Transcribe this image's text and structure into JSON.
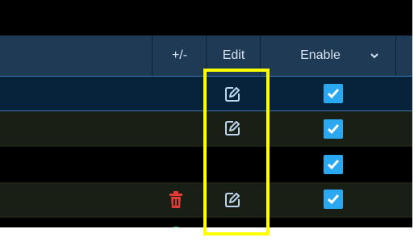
{
  "table": {
    "columns": {
      "plus_minus": "+/-",
      "edit": "Edit",
      "enable": "Enable"
    },
    "rows": [
      {
        "has_edit": true,
        "has_delete": false,
        "enabled": true
      },
      {
        "has_edit": true,
        "has_delete": false,
        "enabled": true
      },
      {
        "has_edit": false,
        "has_delete": false,
        "enabled": true
      },
      {
        "has_edit": true,
        "has_delete": true,
        "enabled": true
      }
    ],
    "add_row_icon": "add-circle-icon"
  },
  "icons": {
    "edit": "edit-pencil-icon",
    "delete": "trash-icon",
    "enable_dropdown": "chevron-down-icon",
    "checkbox": "checkbox-checked-icon"
  },
  "colors": {
    "header_bg": "#1f3a54",
    "checkbox": "#2aa8f1",
    "delete_icon": "#e53935",
    "add_icon": "#22c55e",
    "highlight": "#ffff00"
  }
}
